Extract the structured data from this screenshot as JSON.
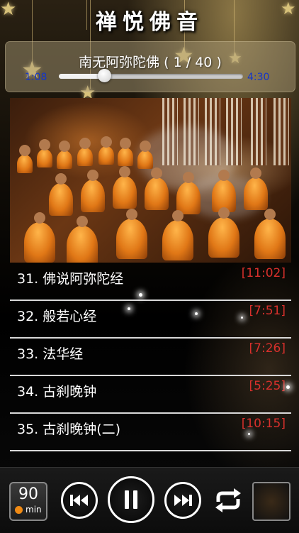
{
  "header": {
    "title": "禅悦佛音"
  },
  "now_playing": {
    "title": "南无阿弥陀佛 ( 1 / 40 )",
    "current_time": "1:08",
    "total_time": "4:30",
    "progress": 0.25
  },
  "cover": {
    "description_icon": "monks-meditating-image"
  },
  "songs": [
    {
      "name": "31. 佛说阿弥陀经",
      "duration": "[11:02]"
    },
    {
      "name": "32. 般若心经",
      "duration": "[7:51]"
    },
    {
      "name": "33. 法华经",
      "duration": "[7:26]"
    },
    {
      "name": "34. 古刹晚钟",
      "duration": "[5:25]"
    },
    {
      "name": "35. 古刹晚钟(二)",
      "duration": "[10:15]"
    }
  ],
  "controls": {
    "timer_value": "90",
    "timer_unit": "min",
    "icons": [
      "timer-icon",
      "previous-icon",
      "pause-icon",
      "next-icon",
      "repeat-icon",
      "thumbnail-icon"
    ]
  },
  "colors": {
    "accent": "#d8302c",
    "time_text": "#1536c9",
    "timer_clock": "#f08a14"
  }
}
